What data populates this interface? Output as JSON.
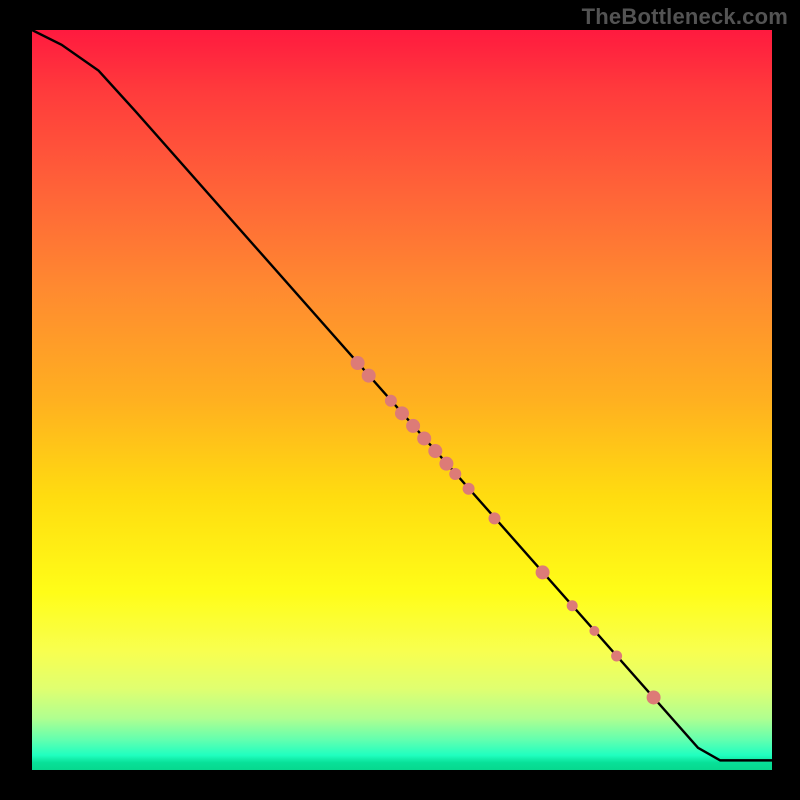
{
  "watermark": "TheBottleneck.com",
  "chart_data": {
    "type": "line",
    "title": "",
    "xlabel": "",
    "ylabel": "",
    "xlim": [
      0,
      100
    ],
    "ylim": [
      0,
      100
    ],
    "grid": false,
    "legend": false,
    "line_points": [
      {
        "x": 0,
        "y": 100
      },
      {
        "x": 4,
        "y": 98
      },
      {
        "x": 9,
        "y": 94.5
      },
      {
        "x": 14,
        "y": 89
      },
      {
        "x": 90,
        "y": 3
      },
      {
        "x": 93,
        "y": 1.3
      },
      {
        "x": 100,
        "y": 1.3
      }
    ],
    "dots": [
      {
        "x": 44,
        "y": 55,
        "r": 7
      },
      {
        "x": 45.5,
        "y": 53.3,
        "r": 7
      },
      {
        "x": 48.5,
        "y": 49.9,
        "r": 6
      },
      {
        "x": 50,
        "y": 48.2,
        "r": 7
      },
      {
        "x": 51.5,
        "y": 46.5,
        "r": 7
      },
      {
        "x": 53,
        "y": 44.8,
        "r": 7
      },
      {
        "x": 54.5,
        "y": 43.1,
        "r": 7
      },
      {
        "x": 56,
        "y": 41.4,
        "r": 7
      },
      {
        "x": 57.2,
        "y": 40.0,
        "r": 6
      },
      {
        "x": 59,
        "y": 38.0,
        "r": 6
      },
      {
        "x": 62.5,
        "y": 34.0,
        "r": 6
      },
      {
        "x": 69,
        "y": 26.7,
        "r": 7
      },
      {
        "x": 73,
        "y": 22.2,
        "r": 5.5
      },
      {
        "x": 76,
        "y": 18.8,
        "r": 5
      },
      {
        "x": 79,
        "y": 15.4,
        "r": 5.5
      },
      {
        "x": 84,
        "y": 9.8,
        "r": 7
      }
    ]
  }
}
